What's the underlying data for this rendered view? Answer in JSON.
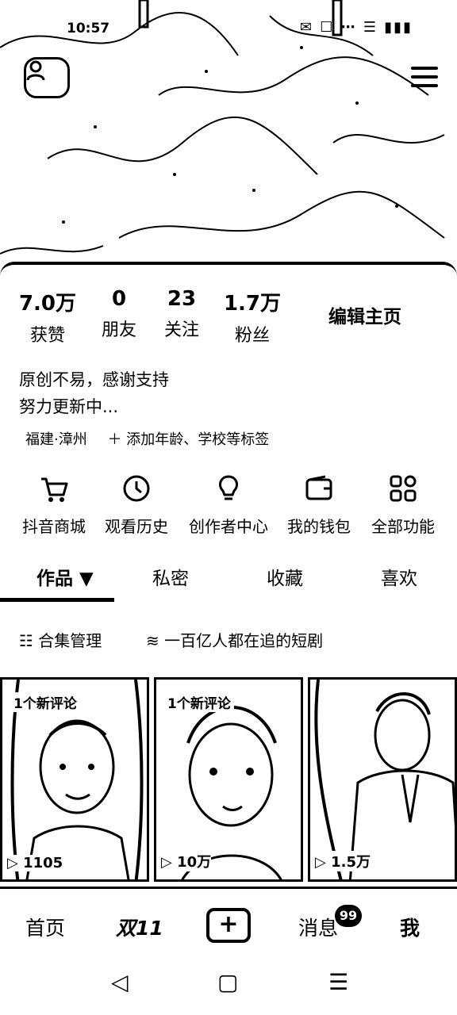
{
  "status_bar": {
    "time": "10:57",
    "icons": "✉ ☐ ⋯ ☰ ▮▮▮"
  },
  "header": {
    "left_icon": "add-friend-icon",
    "right_icon": "menu-icon"
  },
  "stats": [
    {
      "num": "7.0万",
      "label": "获赞"
    },
    {
      "num": "0",
      "label": "朋友"
    },
    {
      "num": "23",
      "label": "关注"
    },
    {
      "num": "1.7万",
      "label": "粉丝"
    }
  ],
  "edit_profile": "编辑主页",
  "bio": {
    "line1": "原创不易，感谢支持",
    "line2": "努力更新中..."
  },
  "tags": {
    "location": "福建·漳州",
    "add": "＋ 添加年龄、学校等标签"
  },
  "features": [
    {
      "icon": "cart-icon",
      "label": "抖音商城"
    },
    {
      "icon": "clock-icon",
      "label": "观看历史"
    },
    {
      "icon": "bulb-icon",
      "label": "创作者中心"
    },
    {
      "icon": "wallet-icon",
      "label": "我的钱包"
    },
    {
      "icon": "grid-icon",
      "label": "全部功能"
    }
  ],
  "tabs": [
    {
      "label": "作品 ▼"
    },
    {
      "label": "私密"
    },
    {
      "label": "收藏"
    },
    {
      "label": "喜欢"
    }
  ],
  "subbar": {
    "collection": "☷ 合集管理",
    "drama": "≋ 一百亿人都在追的短剧"
  },
  "videos": [
    {
      "badge": "1个新评论",
      "plays": "▷ 1105"
    },
    {
      "badge": "1个新评论",
      "plays": "▷ 10万"
    },
    {
      "badge": "",
      "plays": "▷ 1.5万"
    }
  ],
  "bottom_nav": {
    "home": "首页",
    "double11": "双11",
    "plus": "+",
    "messages": "消息",
    "messages_badge": "99",
    "me": "我"
  },
  "system_nav": {
    "back": "◁",
    "home": "▢",
    "recent": "☰"
  }
}
